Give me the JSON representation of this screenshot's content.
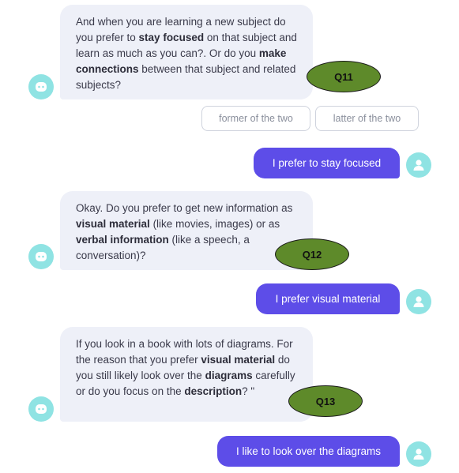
{
  "messages": [
    {
      "role": "bot",
      "segments": [
        {
          "t": "And when you are learning a new subject do you prefer to ",
          "b": false
        },
        {
          "t": "stay focused",
          "b": true
        },
        {
          "t": " on that subject and learn as much as you can?. Or do you ",
          "b": false
        },
        {
          "t": "make connections",
          "b": true
        },
        {
          "t": " between that subject and related subjects?",
          "b": false
        }
      ]
    },
    {
      "role": "user",
      "text": "I prefer to stay focused"
    },
    {
      "role": "bot",
      "segments": [
        {
          "t": "Okay. Do you prefer to get new information as ",
          "b": false
        },
        {
          "t": "visual material",
          "b": true
        },
        {
          "t": " (like movies, images) or as ",
          "b": false
        },
        {
          "t": "verbal information",
          "b": true
        },
        {
          "t": " (like a speech, a conversation)?",
          "b": false
        }
      ]
    },
    {
      "role": "user",
      "text": "I prefer visual material"
    },
    {
      "role": "bot",
      "segments": [
        {
          "t": "If you look in a book with lots of diagrams. For the reason that you prefer ",
          "b": false
        },
        {
          "t": "visual material",
          "b": true
        },
        {
          "t": " do you still likely look over the ",
          "b": false
        },
        {
          "t": "diagrams",
          "b": true
        },
        {
          "t": " carefully or do you focus on the ",
          "b": false
        },
        {
          "t": "description",
          "b": true
        },
        {
          "t": "? \"",
          "b": false
        }
      ]
    },
    {
      "role": "user",
      "text": "I like to look over the diagrams"
    }
  ],
  "quick_replies": [
    "former of the two",
    "latter of the two"
  ],
  "question_labels": [
    "Q11",
    "Q12",
    "Q13"
  ],
  "colors": {
    "bot_bubble": "#eef0f8",
    "user_bubble": "#5d4de8",
    "avatar": "#8fe3e3",
    "question_label_fill": "#5e8a2a"
  },
  "icons": {
    "bot_avatar": "chatbot-face-icon",
    "user_avatar": "user-person-icon"
  }
}
